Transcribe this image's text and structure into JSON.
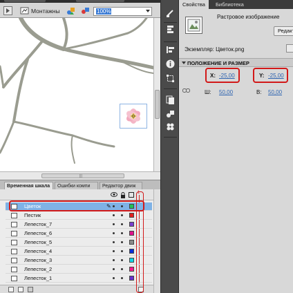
{
  "document_tabs": [
    "",
    ""
  ],
  "toolbar": {
    "scene_label": "Монтажны",
    "zoom_value": "100%"
  },
  "timeline_panel": {
    "tabs": [
      "Временная шкала",
      "Ошибки компи",
      "Редактор движ"
    ],
    "layers": [
      {
        "name": "Цветок",
        "color": "#22c25a",
        "selected": true
      },
      {
        "name": "Пестик",
        "color": "#e02020",
        "selected": false
      },
      {
        "name": "Лепесток_7",
        "color": "#7a3fd0",
        "selected": false
      },
      {
        "name": "Лепесток_6",
        "color": "#e0138c",
        "selected": false
      },
      {
        "name": "Лепесток_5",
        "color": "#8a8a8a",
        "selected": false
      },
      {
        "name": "Лепесток_4",
        "color": "#0a2ed9",
        "selected": false
      },
      {
        "name": "Лепесток_3",
        "color": "#10d5e6",
        "selected": false
      },
      {
        "name": "Лепесток_2",
        "color": "#ff1a8c",
        "selected": false
      },
      {
        "name": "Лепесток_1",
        "color": "#6b2fcf",
        "selected": false
      }
    ]
  },
  "properties": {
    "tabs": [
      "Свойства",
      "Библиотека"
    ],
    "object_type": "Растровое изображение",
    "edit_button": "Редакт",
    "instance_label": "Экземпляр: Цветок.png",
    "section_title": "ПОЛОЖЕНИЕ И РАЗМЕР",
    "x_label": "X:",
    "x_value": "-25,00",
    "y_label": "Y:",
    "y_value": "-25,00",
    "w_label": "Ш:",
    "w_value": "50,00",
    "h_label": "В:",
    "h_value": "50,00"
  },
  "colors": {
    "accent_selection": "#7fb2e6",
    "highlight_red": "#d21818",
    "branch_color": "#9a9c90"
  }
}
